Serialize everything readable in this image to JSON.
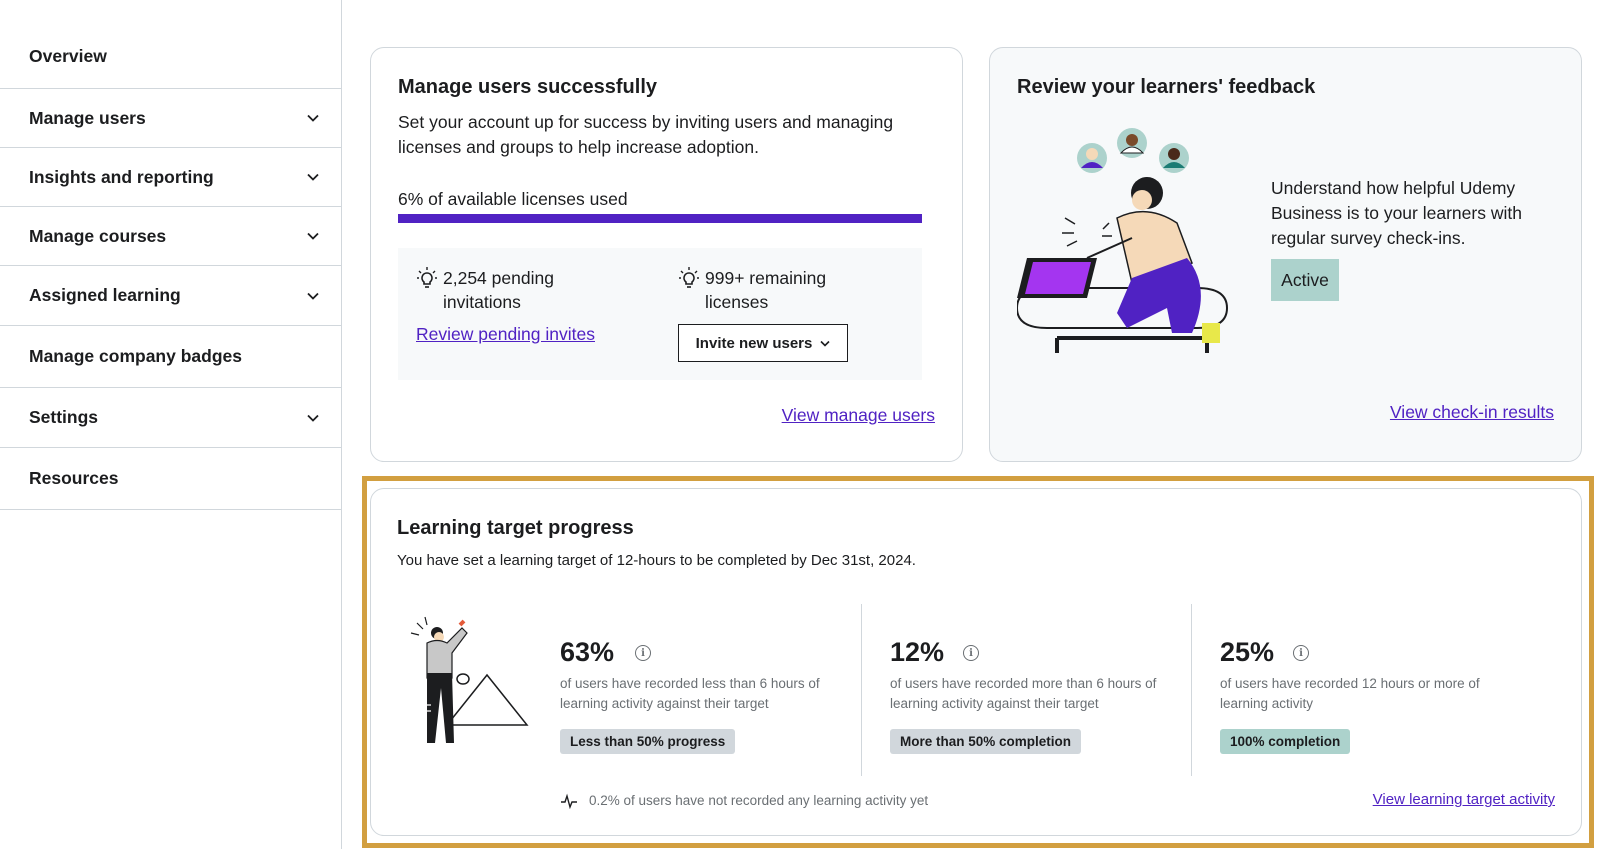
{
  "sidebar": {
    "items": [
      {
        "label": "Overview",
        "expandable": false
      },
      {
        "label": "Manage users",
        "expandable": true
      },
      {
        "label": "Insights and reporting",
        "expandable": true
      },
      {
        "label": "Manage courses",
        "expandable": true
      },
      {
        "label": "Assigned learning",
        "expandable": true
      },
      {
        "label": "Manage company badges",
        "expandable": false
      },
      {
        "label": "Settings",
        "expandable": true
      },
      {
        "label": "Resources",
        "expandable": false
      }
    ]
  },
  "manage_users_card": {
    "title": "Manage users successfully",
    "description": "Set your account up for success by inviting users and managing licenses and groups to help increase adoption.",
    "license_usage_label": "6% of available licenses used",
    "license_usage_percent": 6,
    "pending_invitations_line1": "2,254 pending",
    "pending_invitations_line2": "invitations",
    "remaining_licenses_line1": "999+ remaining",
    "remaining_licenses_line2": "licenses",
    "review_invites_link": "Review pending invites",
    "invite_button": "Invite new users",
    "view_link": "View manage users"
  },
  "feedback_card": {
    "title": "Review your learners' feedback",
    "description": "Understand how helpful Udemy Business is to your learners with regular survey check-ins.",
    "status_badge": "Active",
    "view_link": "View check-in results"
  },
  "learning_target": {
    "title": "Learning target progress",
    "subtitle": "You have set a learning target of 12-hours to be completed by Dec 31st, 2024.",
    "stats": [
      {
        "percent": "63%",
        "description": "of users have recorded less than 6 hours of learning activity against their target",
        "tag": "Less than 50% progress",
        "tag_color": "#d1d7dc"
      },
      {
        "percent": "12%",
        "description": "of users have recorded more than 6 hours of learning activity against their target",
        "tag": "More than 50% completion",
        "tag_color": "#d1d7dc"
      },
      {
        "percent": "25%",
        "description": "of users have recorded 12 hours or more of learning activity",
        "tag": "100% completion",
        "tag_color": "#acd2cc"
      }
    ],
    "no_activity_note": "0.2% of users have not recorded any learning activity yet",
    "view_link": "View learning target activity"
  },
  "colors": {
    "accent": "#5022c3",
    "highlight_border": "#d29f40",
    "active_badge": "#acd2cc"
  }
}
